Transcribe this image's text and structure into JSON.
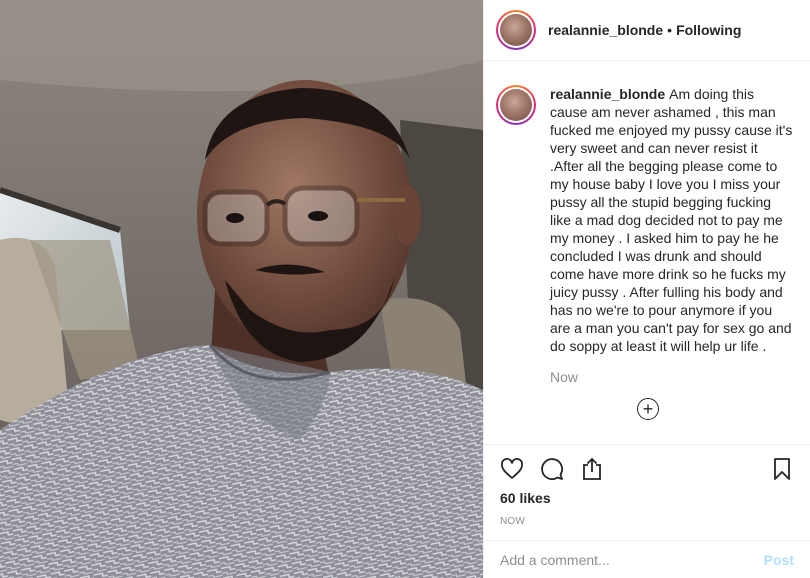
{
  "header": {
    "username": "realannie_blonde",
    "separator": "•",
    "follow_status": "Following"
  },
  "caption": {
    "username": "realannie_blonde",
    "text": "Am doing this cause am never ashamed , this man fucked me enjoyed my pussy cause it's very sweet and can never resist it .After all the begging please come to my house baby I love you I miss your pussy all the stupid begging fucking like a mad dog decided not to pay me my money . I asked him to pay he he concluded I was drunk and should come have more drink so he fucks my juicy pussy . After fulling his body and has no we're to pour anymore if you are a man you can't pay for sex go and do soppy at least it will help ur life .",
    "time": "Now"
  },
  "load_more_icon": "plus-circle-icon",
  "actions": {
    "icons": [
      "heart-icon",
      "comment-icon",
      "share-icon",
      "bookmark-icon"
    ],
    "likes": "60 likes",
    "post_time": "NOW"
  },
  "comment_box": {
    "placeholder": "Add a comment...",
    "post_label": "Post",
    "post_color": "#b2dffc"
  },
  "colors": {
    "text": "#262626",
    "muted": "#8e8e8e",
    "border": "#efefef"
  }
}
